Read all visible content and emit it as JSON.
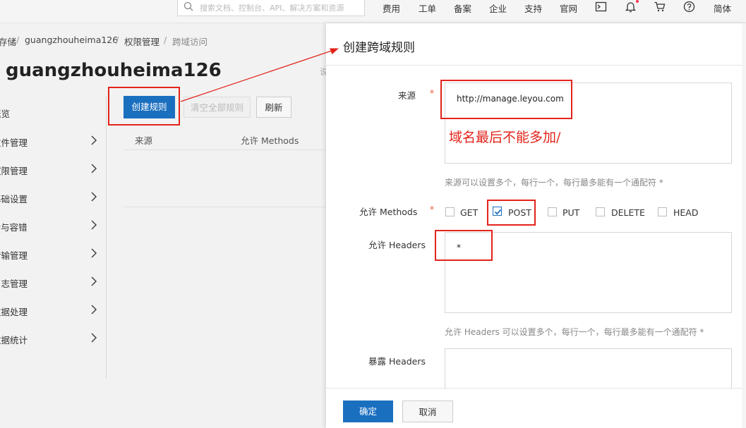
{
  "topbar": {
    "search_placeholder": "搜索文档、控制台、API、解决方案和资源",
    "links": [
      "费用",
      "工单",
      "备案",
      "企业",
      "支持",
      "官网"
    ],
    "lang": "简体",
    "icons": [
      "search-icon",
      "terminal-icon",
      "bell-icon",
      "cart-icon",
      "help-icon"
    ]
  },
  "breadcrumb": {
    "items": [
      "存储",
      "guangzhouheima126",
      "权限管理",
      "跨域访问"
    ],
    "separator": "/"
  },
  "bucket_title": "guangzhouheima126",
  "bg_stray_text": "说",
  "sidebar": {
    "items": [
      {
        "label": "概览",
        "has_chevron": false
      },
      {
        "label": "文件管理",
        "has_chevron": true
      },
      {
        "label": "权限管理",
        "has_chevron": true
      },
      {
        "label": "基础设置",
        "has_chevron": true
      },
      {
        "label": "冗余与容错",
        "has_chevron": true
      },
      {
        "label": "传输管理",
        "has_chevron": true
      },
      {
        "label": "日志管理",
        "has_chevron": true
      },
      {
        "label": "数据处理",
        "has_chevron": true
      },
      {
        "label": "数据统计",
        "has_chevron": true
      }
    ]
  },
  "toolbar": {
    "create_label": "创建规则",
    "clear_label": "清空全部规则",
    "refresh_label": "刷新"
  },
  "table": {
    "columns": [
      "来源",
      "允许 Methods"
    ]
  },
  "drawer": {
    "title": "创建跨域规则",
    "source": {
      "label": "来源",
      "required_mark": "*",
      "value": "http://manage.leyou.com",
      "annotation": "域名最后不能多加/",
      "hint": "来源可以设置多个，每行一个，每行最多能有一个通配符 *"
    },
    "methods": {
      "label": "允许 Methods",
      "required_mark": "*",
      "options": [
        {
          "label": "GET",
          "checked": false
        },
        {
          "label": "POST",
          "checked": true
        },
        {
          "label": "PUT",
          "checked": false
        },
        {
          "label": "DELETE",
          "checked": false
        },
        {
          "label": "HEAD",
          "checked": false
        }
      ]
    },
    "allow_headers": {
      "label": "允许 Headers",
      "value": "*",
      "hint": "允许 Headers 可以设置多个，每行一个，每行最多能有一个通配符 *"
    },
    "expose_headers": {
      "label": "暴露 Headers",
      "value": ""
    },
    "ok_label": "确定",
    "cancel_label": "取消"
  },
  "colors": {
    "primary": "#1a6fbf",
    "annotation_red": "#e2231a",
    "required_red": "#e53"
  }
}
